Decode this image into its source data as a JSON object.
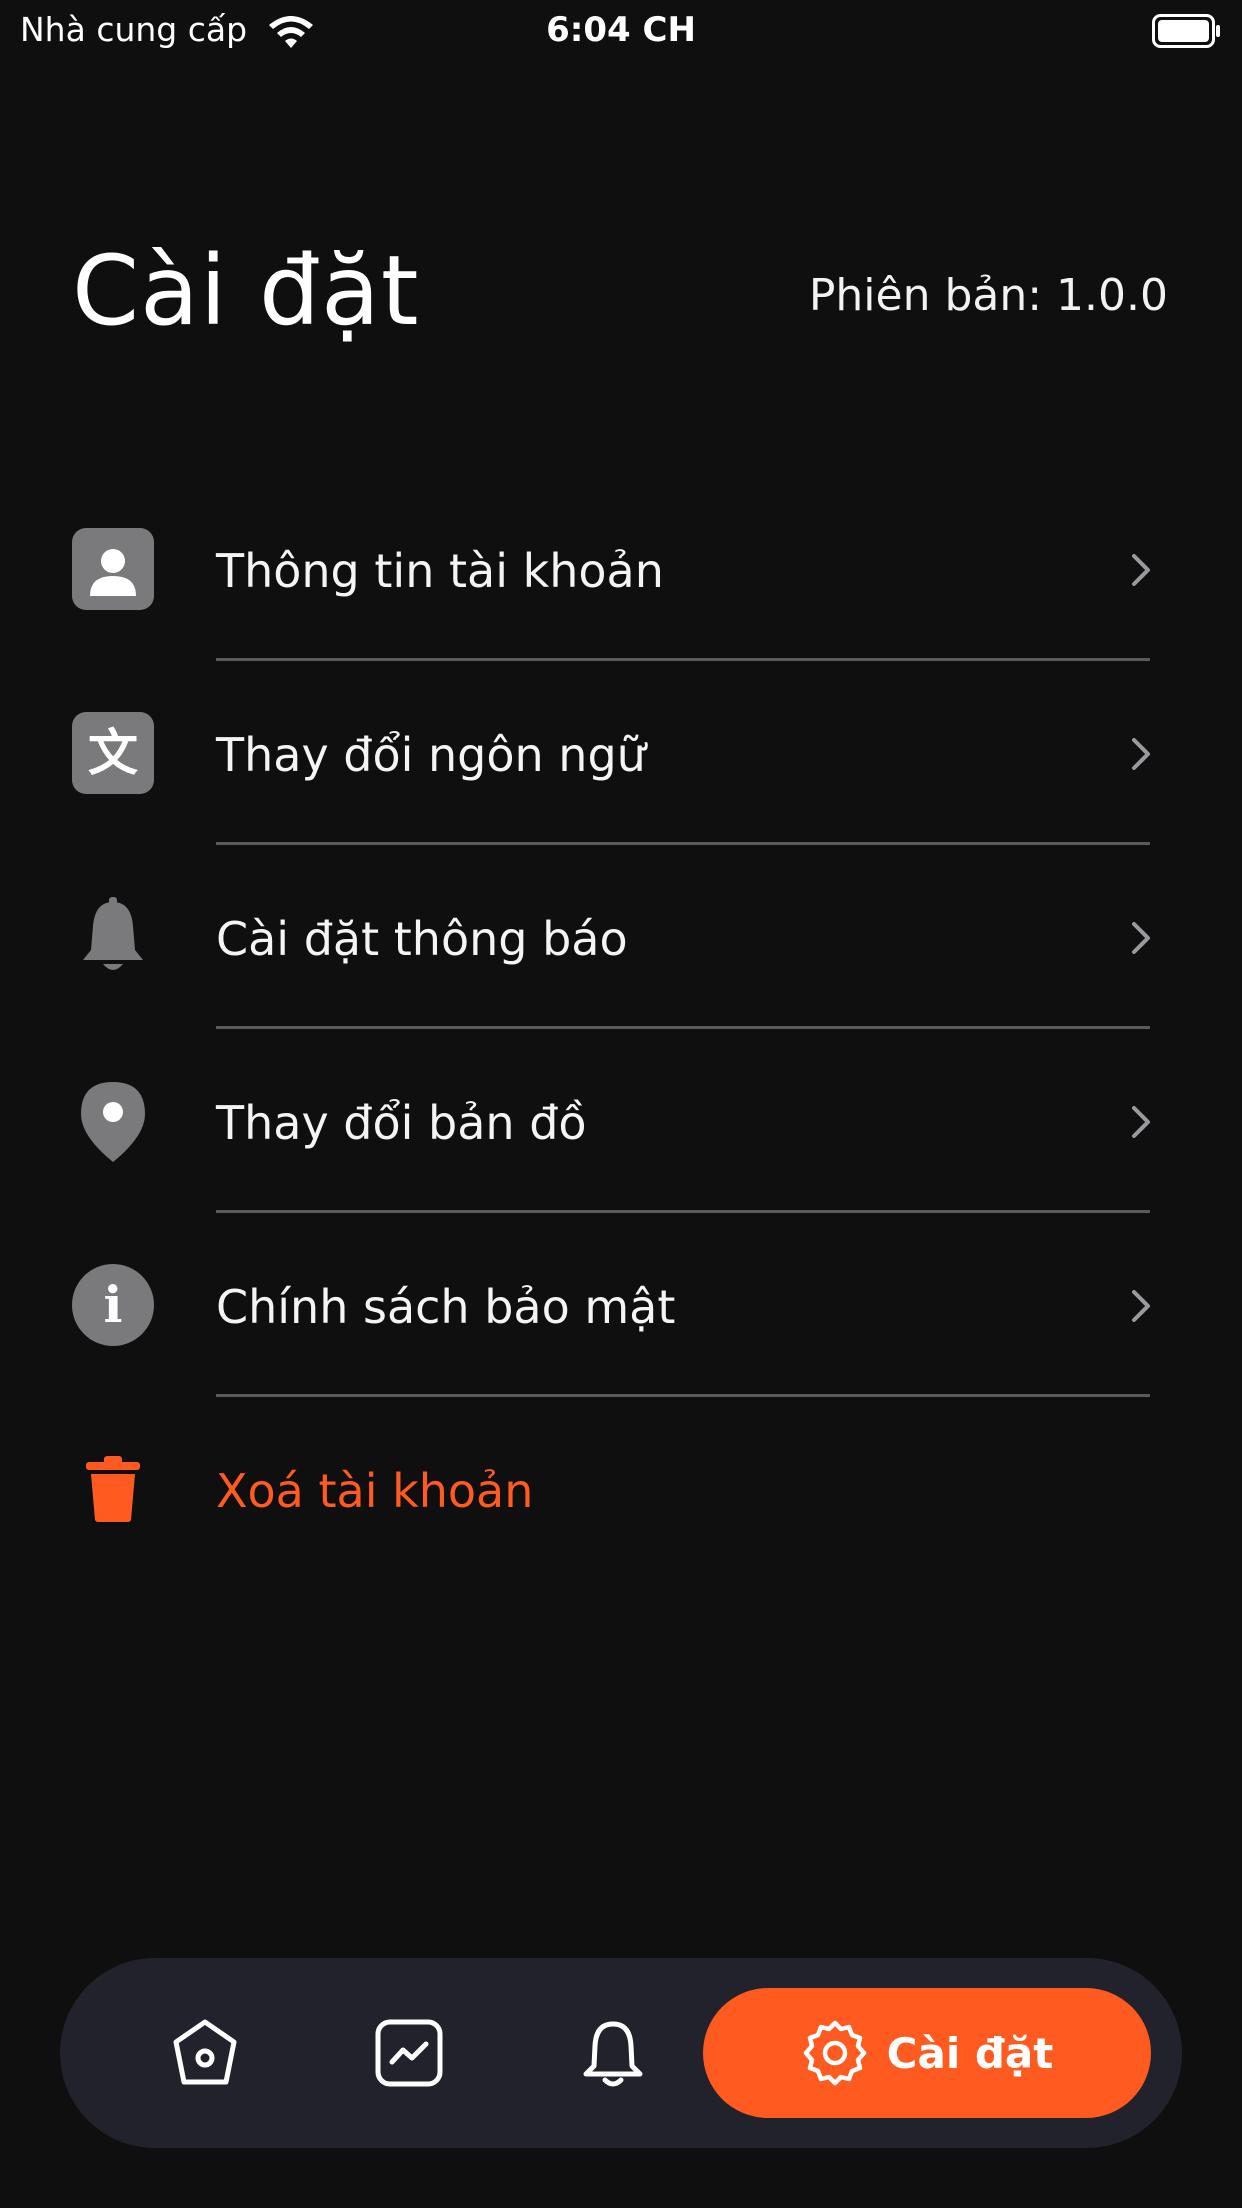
{
  "status_bar": {
    "carrier": "Nhà cung cấp",
    "time": "6:04 CH"
  },
  "header": {
    "title": "Cài đặt",
    "version": "Phiên bản: 1.0.0"
  },
  "settings": {
    "items": [
      {
        "label": "Thông tin tài khoản",
        "icon": "person-icon"
      },
      {
        "label": "Thay đổi ngôn ngữ",
        "icon": "translate-icon",
        "glyph": "文"
      },
      {
        "label": "Cài đặt thông báo",
        "icon": "bell-icon"
      },
      {
        "label": "Thay đổi bản đồ",
        "icon": "map-pin-icon"
      },
      {
        "label": "Chính sách bảo mật",
        "icon": "info-icon",
        "glyph": "i"
      }
    ],
    "delete_account": {
      "label": "Xoá tài khoản",
      "icon": "trash-icon"
    }
  },
  "bottom_nav": {
    "items": [
      {
        "icon": "home-icon"
      },
      {
        "icon": "chart-icon"
      },
      {
        "icon": "bell-icon"
      },
      {
        "icon": "gear-icon",
        "label": "Cài đặt",
        "active": true
      }
    ]
  },
  "colors": {
    "accent": "#ff5a1f",
    "background": "#0f0f10",
    "icon_gray": "#7a7a7c",
    "nav_bg": "#22222c"
  }
}
